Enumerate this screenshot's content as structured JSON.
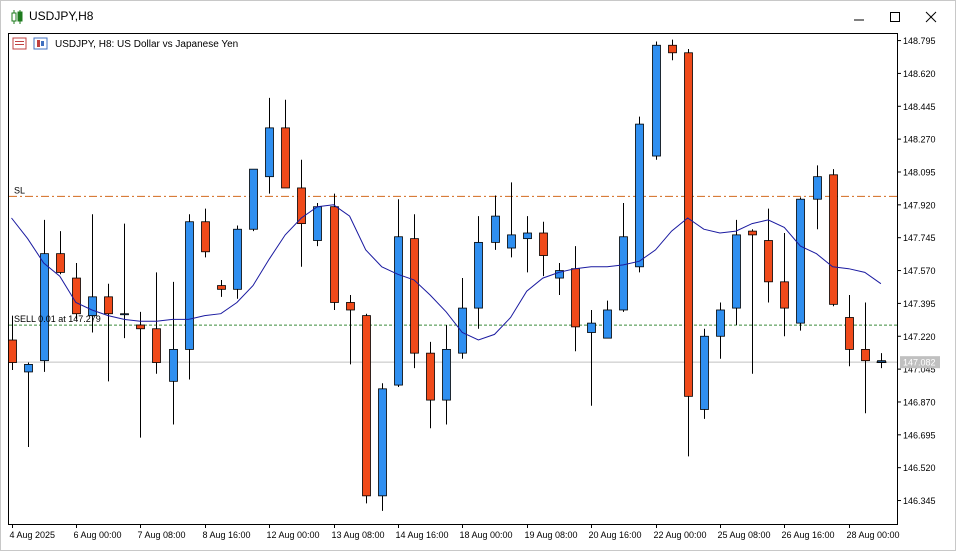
{
  "window": {
    "title": "USDJPY,H8",
    "minimize_icon": "minimize-icon",
    "maximize_icon": "maximize-icon",
    "close_icon": "close-icon"
  },
  "colors": {
    "bull": "#2f8ff0",
    "bear": "#f04a1a",
    "ma": "#1a1aa0",
    "sl_line": "#d2691e",
    "entry_line": "#3a8a3a",
    "current_line": "#c0c0c0",
    "price_tag_bg": "#c0c0c0"
  },
  "chart_data": {
    "type": "candlestick",
    "symbol_header": "USDJPY, H8:  US Dollar vs Japanese Yen",
    "ylim": [
      146.22,
      148.83
    ],
    "y_ticks": [
      "148.795",
      "148.620",
      "148.445",
      "148.270",
      "148.095",
      "147.920",
      "147.745",
      "147.570",
      "147.395",
      "147.220",
      "147.045",
      "146.870",
      "146.695",
      "146.520",
      "146.345"
    ],
    "x_ticks": [
      "4 Aug 2025",
      "6 Aug 00:00",
      "7 Aug 08:00",
      "8 Aug 16:00",
      "12 Aug 00:00",
      "13 Aug 08:00",
      "14 Aug 16:00",
      "18 Aug 00:00",
      "19 Aug 08:00",
      "20 Aug 16:00",
      "22 Aug 00:00",
      "25 Aug 08:00",
      "26 Aug 16:00",
      "28 Aug 00:00"
    ],
    "x_tick_candle_index": [
      0,
      4,
      8,
      12,
      16,
      20,
      24,
      28,
      32,
      36,
      40,
      44,
      48,
      52
    ],
    "sl_label": "SL",
    "sl_price": 147.965,
    "entry_label": "SELL 0.01 at 147.279",
    "entry_price": 147.279,
    "current_price_label": "147.082",
    "current_price": 147.082,
    "candles": [
      {
        "o": 147.2,
        "h": 147.33,
        "l": 147.04,
        "c": 147.08
      },
      {
        "o": 147.03,
        "h": 147.08,
        "l": 146.63,
        "c": 147.07
      },
      {
        "o": 147.09,
        "h": 147.84,
        "l": 147.03,
        "c": 147.66
      },
      {
        "o": 147.66,
        "h": 147.78,
        "l": 147.55,
        "c": 147.56
      },
      {
        "o": 147.53,
        "h": 147.61,
        "l": 147.31,
        "c": 147.34
      },
      {
        "o": 147.33,
        "h": 147.87,
        "l": 147.24,
        "c": 147.43
      },
      {
        "o": 147.43,
        "h": 147.5,
        "l": 146.98,
        "c": 147.34
      },
      {
        "o": 147.34,
        "h": 147.82,
        "l": 147.21,
        "c": 147.34
      },
      {
        "o": 147.28,
        "h": 147.35,
        "l": 146.68,
        "c": 147.26
      },
      {
        "o": 147.26,
        "h": 147.56,
        "l": 147.02,
        "c": 147.08
      },
      {
        "o": 146.98,
        "h": 147.51,
        "l": 146.75,
        "c": 147.15
      },
      {
        "o": 147.15,
        "h": 147.87,
        "l": 146.99,
        "c": 147.83
      },
      {
        "o": 147.83,
        "h": 147.9,
        "l": 147.64,
        "c": 147.67
      },
      {
        "o": 147.49,
        "h": 147.52,
        "l": 147.43,
        "c": 147.47
      },
      {
        "o": 147.47,
        "h": 147.81,
        "l": 147.42,
        "c": 147.79
      },
      {
        "o": 147.79,
        "h": 148.11,
        "l": 147.78,
        "c": 148.11
      },
      {
        "o": 148.07,
        "h": 148.49,
        "l": 147.98,
        "c": 148.33
      },
      {
        "o": 148.33,
        "h": 148.48,
        "l": 148.01,
        "c": 148.01
      },
      {
        "o": 148.01,
        "h": 148.16,
        "l": 147.59,
        "c": 147.82
      },
      {
        "o": 147.73,
        "h": 147.93,
        "l": 147.7,
        "c": 147.91
      },
      {
        "o": 147.91,
        "h": 147.98,
        "l": 147.36,
        "c": 147.4
      },
      {
        "o": 147.4,
        "h": 147.44,
        "l": 147.07,
        "c": 147.36
      },
      {
        "o": 147.33,
        "h": 147.34,
        "l": 146.33,
        "c": 146.37
      },
      {
        "o": 146.37,
        "h": 146.97,
        "l": 146.29,
        "c": 146.94
      },
      {
        "o": 146.96,
        "h": 147.95,
        "l": 146.95,
        "c": 147.75
      },
      {
        "o": 147.74,
        "h": 147.87,
        "l": 147.05,
        "c": 147.13
      },
      {
        "o": 147.13,
        "h": 147.19,
        "l": 146.73,
        "c": 146.88
      },
      {
        "o": 146.88,
        "h": 147.28,
        "l": 146.75,
        "c": 147.15
      },
      {
        "o": 147.13,
        "h": 147.53,
        "l": 147.1,
        "c": 147.37
      },
      {
        "o": 147.37,
        "h": 147.86,
        "l": 147.26,
        "c": 147.72
      },
      {
        "o": 147.72,
        "h": 147.97,
        "l": 147.68,
        "c": 147.86
      },
      {
        "o": 147.69,
        "h": 148.04,
        "l": 147.64,
        "c": 147.76
      },
      {
        "o": 147.74,
        "h": 147.86,
        "l": 147.56,
        "c": 147.77
      },
      {
        "o": 147.77,
        "h": 147.83,
        "l": 147.54,
        "c": 147.65
      },
      {
        "o": 147.53,
        "h": 147.61,
        "l": 147.44,
        "c": 147.57
      },
      {
        "o": 147.58,
        "h": 147.7,
        "l": 147.14,
        "c": 147.27
      },
      {
        "o": 147.24,
        "h": 147.36,
        "l": 146.85,
        "c": 147.29
      },
      {
        "o": 147.21,
        "h": 147.41,
        "l": 147.21,
        "c": 147.36
      },
      {
        "o": 147.36,
        "h": 147.93,
        "l": 147.35,
        "c": 147.75
      },
      {
        "o": 147.59,
        "h": 148.39,
        "l": 147.56,
        "c": 148.35
      },
      {
        "o": 148.18,
        "h": 148.79,
        "l": 148.16,
        "c": 148.77
      },
      {
        "o": 148.77,
        "h": 148.8,
        "l": 148.69,
        "c": 148.73
      },
      {
        "o": 148.73,
        "h": 148.75,
        "l": 146.58,
        "c": 146.9
      },
      {
        "o": 146.83,
        "h": 147.26,
        "l": 146.78,
        "c": 147.22
      },
      {
        "o": 147.22,
        "h": 147.4,
        "l": 147.1,
        "c": 147.36
      },
      {
        "o": 147.37,
        "h": 147.84,
        "l": 147.28,
        "c": 147.76
      },
      {
        "o": 147.78,
        "h": 147.79,
        "l": 147.02,
        "c": 147.76
      },
      {
        "o": 147.73,
        "h": 147.9,
        "l": 147.4,
        "c": 147.51
      },
      {
        "o": 147.51,
        "h": 147.77,
        "l": 147.22,
        "c": 147.37
      },
      {
        "o": 147.29,
        "h": 147.96,
        "l": 147.25,
        "c": 147.95
      },
      {
        "o": 147.95,
        "h": 148.13,
        "l": 147.79,
        "c": 148.07
      },
      {
        "o": 148.08,
        "h": 148.11,
        "l": 147.38,
        "c": 147.39
      },
      {
        "o": 147.32,
        "h": 147.44,
        "l": 147.06,
        "c": 147.15
      },
      {
        "o": 147.15,
        "h": 147.4,
        "l": 146.81,
        "c": 147.09
      },
      {
        "o": 147.08,
        "h": 147.13,
        "l": 147.05,
        "c": 147.09
      }
    ],
    "ma": [
      147.85,
      147.74,
      147.61,
      147.54,
      147.4,
      147.36,
      147.33,
      147.31,
      147.3,
      147.3,
      147.31,
      147.31,
      147.33,
      147.34,
      147.4,
      147.49,
      147.63,
      147.76,
      147.85,
      147.91,
      147.92,
      147.86,
      147.68,
      147.59,
      147.55,
      147.52,
      147.44,
      147.35,
      147.24,
      147.2,
      147.23,
      147.32,
      147.46,
      147.53,
      147.56,
      147.58,
      147.59,
      147.59,
      147.6,
      147.62,
      147.68,
      147.78,
      147.85,
      147.79,
      147.77,
      147.78,
      147.82,
      147.84,
      147.8,
      147.7,
      147.66,
      147.59,
      147.58,
      147.56,
      147.5
    ]
  }
}
